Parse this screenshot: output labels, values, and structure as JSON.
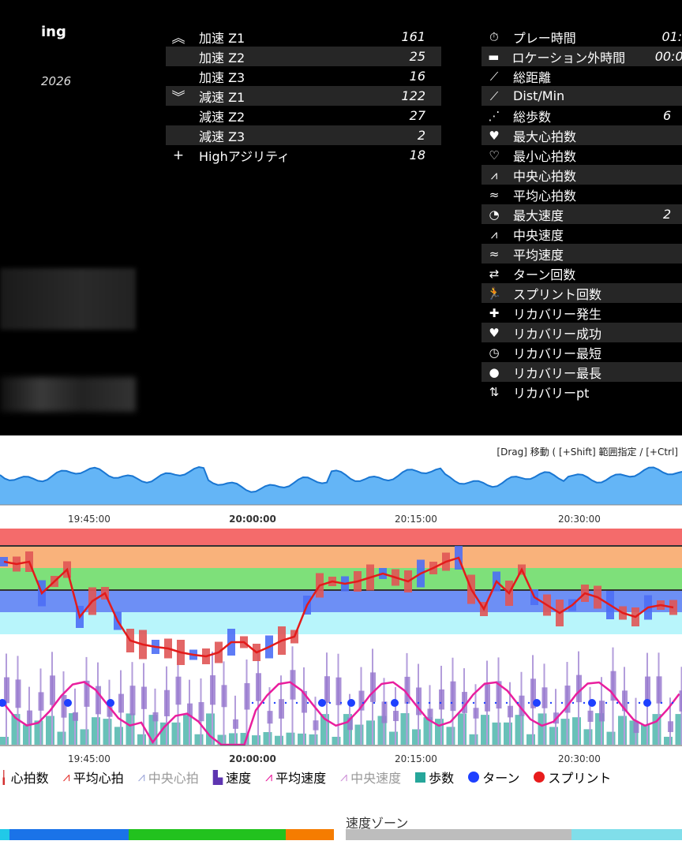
{
  "header": {
    "title": "ing",
    "year": "2026"
  },
  "accel_table": [
    {
      "icon": "double-chevron-up-icon",
      "glyph": "︽",
      "label": "加速 Z1",
      "value": "161"
    },
    {
      "icon": "",
      "glyph": "",
      "label": "加速 Z2",
      "value": "25"
    },
    {
      "icon": "",
      "glyph": "",
      "label": "加速 Z3",
      "value": "16"
    },
    {
      "icon": "double-chevron-down-icon",
      "glyph": "︾",
      "label": "減速 Z1",
      "value": "122"
    },
    {
      "icon": "",
      "glyph": "",
      "label": "減速 Z2",
      "value": "27"
    },
    {
      "icon": "",
      "glyph": "",
      "label": "減速 Z3",
      "value": "2"
    },
    {
      "icon": "plus-icon",
      "glyph": "+",
      "label": "Highアジリティ",
      "value": "18"
    }
  ],
  "stats_table": [
    {
      "icon": "stopwatch-icon",
      "glyph": "⏱",
      "label": "プレー時間",
      "value": "01:"
    },
    {
      "icon": "bed-icon",
      "glyph": "▬",
      "label": "ロケーション外時間",
      "value": "00:0"
    },
    {
      "icon": "ruler-icon",
      "glyph": "⟋",
      "label": "総距離",
      "value": ""
    },
    {
      "icon": "ruler-icon",
      "glyph": "⟋",
      "label": "Dist/Min",
      "value": ""
    },
    {
      "icon": "footsteps-icon",
      "glyph": "⋰",
      "label": "総歩数",
      "value": "6"
    },
    {
      "icon": "heart-pulse-icon",
      "glyph": "♥",
      "label": "最大心拍数",
      "value": ""
    },
    {
      "icon": "heart-outline-icon",
      "glyph": "♡",
      "label": "最小心拍数",
      "value": ""
    },
    {
      "icon": "line-chart-icon",
      "glyph": "⩘",
      "label": "中央心拍数",
      "value": ""
    },
    {
      "icon": "average-icon",
      "glyph": "≈",
      "label": "平均心拍数",
      "value": ""
    },
    {
      "icon": "speedometer-icon",
      "glyph": "◔",
      "label": "最大速度",
      "value": "2"
    },
    {
      "icon": "line-chart-icon",
      "glyph": "⩘",
      "label": "中央速度",
      "value": ""
    },
    {
      "icon": "average-icon",
      "glyph": "≈",
      "label": "平均速度",
      "value": ""
    },
    {
      "icon": "swap-icon",
      "glyph": "⇄",
      "label": "ターン回数",
      "value": ""
    },
    {
      "icon": "running-icon",
      "glyph": "🏃",
      "label": "スプリント回数",
      "value": ""
    },
    {
      "icon": "medical-bag-icon",
      "glyph": "✚",
      "label": "リカバリー発生",
      "value": ""
    },
    {
      "icon": "hand-heart-icon",
      "glyph": "♥",
      "label": "リカバリー成功",
      "value": ""
    },
    {
      "icon": "clock-outline-icon",
      "glyph": "◷",
      "label": "リカバリー最短",
      "value": ""
    },
    {
      "icon": "clock-icon",
      "glyph": "●",
      "label": "リカバリー最長",
      "value": ""
    },
    {
      "icon": "arrows-up-down-icon",
      "glyph": "⇅",
      "label": "リカバリーpt",
      "value": ""
    }
  ],
  "chart": {
    "hint": "[Drag] 移動 ( [+Shift] 範囲指定 / [+Ctrl]",
    "time_ticks": [
      "19:45:00",
      "20:00:00",
      "20:15:00",
      "20:30:00"
    ],
    "bold_tick": "20:00:00"
  },
  "legend": [
    {
      "icon": "candlestick-icon",
      "label": "心拍数",
      "color": "#d32f2f"
    },
    {
      "icon": "line-chart-icon",
      "label": "平均心拍",
      "color": "#e53935"
    },
    {
      "icon": "line-chart-icon",
      "label": "中央心拍",
      "color": "#9fa8da"
    },
    {
      "icon": "bar-chart-icon",
      "label": "速度",
      "color": "#5e35b1"
    },
    {
      "icon": "line-chart-icon",
      "label": "平均速度",
      "color": "#e91e9e"
    },
    {
      "icon": "line-chart-icon",
      "label": "中央速度",
      "color": "#ce93d8"
    },
    {
      "icon": "square-icon",
      "label": "歩数",
      "color": "#26a69a"
    },
    {
      "icon": "circle-icon",
      "label": "ターン",
      "color": "#1e40ff"
    },
    {
      "icon": "circle-icon",
      "label": "スプリント",
      "color": "#e81c1c"
    }
  ],
  "speed_zone": {
    "title": "速度ゾーン",
    "colors": [
      "#21c9e8",
      "#1a73e8",
      "#22c21e",
      "#f57c00",
      "#bdbdbd",
      "#80deea"
    ]
  }
}
